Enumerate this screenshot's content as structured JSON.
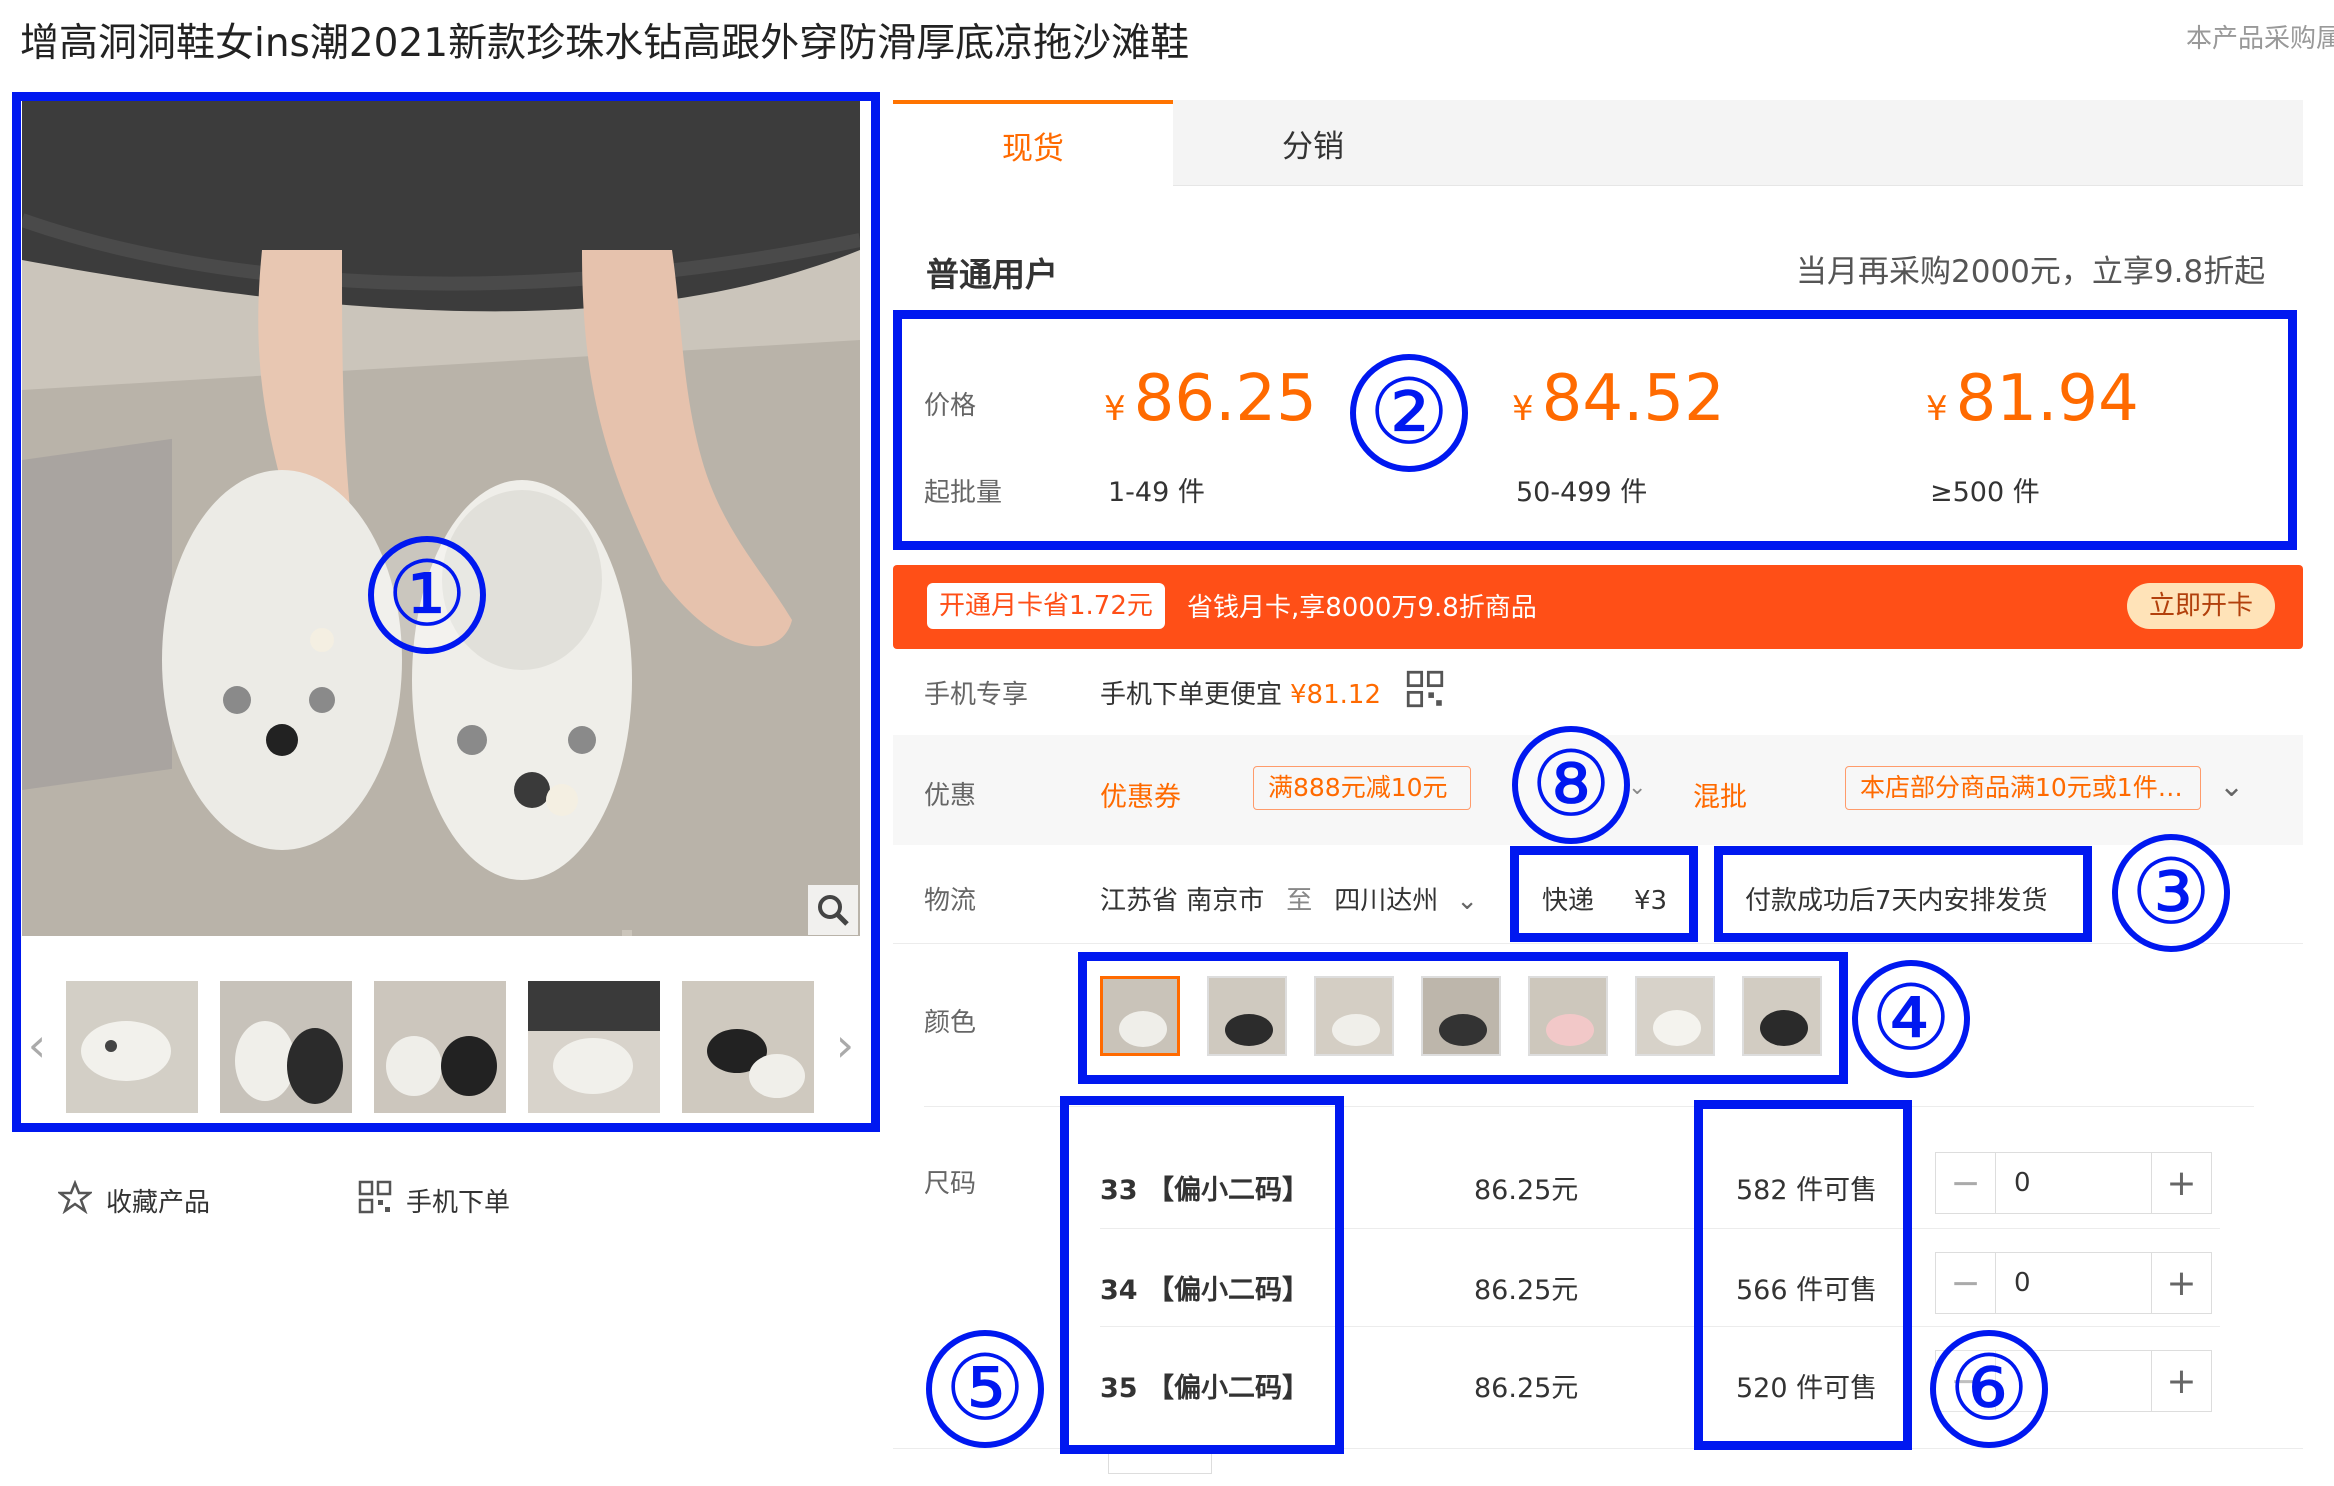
{
  "product": {
    "title": "增高洞洞鞋女ins潮2021新款珍珠水钻高跟外穿防滑厚底凉拖沙滩鞋",
    "corner_note": "本产品采购属"
  },
  "gallery": {
    "actions": {
      "favorite_label": "收藏产品",
      "mobile_order_label": "手机下单"
    }
  },
  "tabs": [
    {
      "label": "现货",
      "active": true
    },
    {
      "label": "分销",
      "active": false
    }
  ],
  "pricing": {
    "user_type": "普通用户",
    "promo_note": "当月再采购2000元，立享9.8折起",
    "price_label": "价格",
    "moq_label": "起批量",
    "currency": "¥",
    "tiers": [
      {
        "price": "86.25",
        "range": "1-49 件"
      },
      {
        "price": "84.52",
        "range": "50-499 件"
      },
      {
        "price": "81.94",
        "range": "≥500 件"
      }
    ]
  },
  "member_card": {
    "tag": "开通月卡省1.72元",
    "desc": "省钱月卡,享8000万9.8折商品",
    "button": "立即开卡"
  },
  "mobile_exclusive": {
    "label": "手机专享",
    "text": "手机下单更便宜",
    "price": "¥81.12"
  },
  "discount": {
    "label": "优惠",
    "coupon_type": "优惠券",
    "coupon": "满888元减10元",
    "mix_type": "混批",
    "mix": "本店部分商品满10元或1件…"
  },
  "logistics": {
    "label": "物流",
    "origin": "江苏省 南京市",
    "to": "至",
    "destination": "四川达州",
    "method": "快递",
    "fee": "¥3",
    "ship_note": "付款成功后7天内安排发货"
  },
  "color": {
    "label": "颜色",
    "swatch_count": 7,
    "selected_index": 0
  },
  "size": {
    "label": "尺码",
    "rows": [
      {
        "name": "33 【偏小二码】",
        "price": "86.25元",
        "stock": "582 件可售",
        "qty": "0"
      },
      {
        "name": "34 【偏小二码】",
        "price": "86.25元",
        "stock": "566 件可售",
        "qty": "0"
      },
      {
        "name": "35 【偏小二码】",
        "price": "86.25元",
        "stock": "520 件可售",
        "qty": ""
      }
    ]
  },
  "annotations": [
    "①",
    "②",
    "③",
    "④",
    "⑤",
    "⑥",
    "⑧"
  ],
  "colors": {
    "accent": "#ff6a00",
    "member_bar": "#ff4f17",
    "annotation": "#0018f0"
  }
}
